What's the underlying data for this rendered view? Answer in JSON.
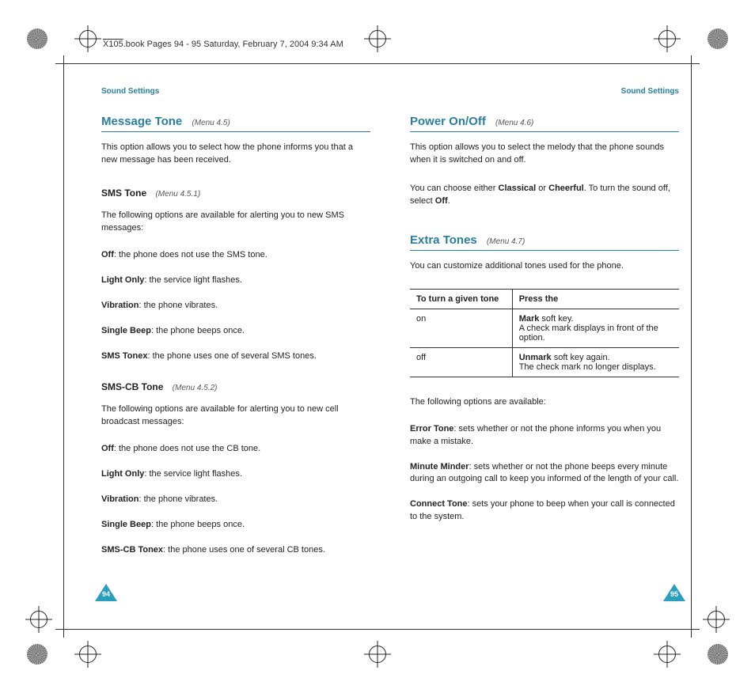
{
  "book_header": "X105.book  Pages 94 - 95  Saturday, February 7, 2004  9:34 AM",
  "runner_left": "Sound Settings",
  "runner_right": "Sound Settings",
  "left": {
    "title": "Message Tone",
    "title_ref": "(Menu 4.5)",
    "intro": "This option allows you to select how the phone informs you that a new message has been received.",
    "sub1_title": "SMS Tone",
    "sub1_ref": "(Menu 4.5.1)",
    "sub1_intro": "The following options are available for alerting you to new SMS messages:",
    "sub1_opts": [
      {
        "b": "Off",
        "t": ": the phone does not use the SMS tone."
      },
      {
        "b": "Light Only",
        "t": ": the service light flashes."
      },
      {
        "b": "Vibration",
        "t": ": the phone vibrates."
      },
      {
        "b": "Single Beep",
        "t": ": the phone beeps once."
      },
      {
        "b": "SMS Tonex",
        "t": ": the phone uses one of several SMS tones."
      }
    ],
    "sub2_title": "SMS-CB Tone",
    "sub2_ref": "(Menu 4.5.2)",
    "sub2_intro": "The following options are available for alerting you to new cell broadcast messages:",
    "sub2_opts": [
      {
        "b": "Off",
        "t": ": the phone does not use the CB tone."
      },
      {
        "b": "Light Only",
        "t": ": the service light flashes."
      },
      {
        "b": "Vibration",
        "t": ": the phone vibrates."
      },
      {
        "b": "Single Beep",
        "t": ": the phone beeps once."
      },
      {
        "b": "SMS-CB Tonex",
        "t": ": the phone uses one of several CB tones."
      }
    ],
    "page_no": "94"
  },
  "right": {
    "title1": "Power On/Off",
    "title1_ref": "(Menu 4.6)",
    "p1a": "This option allows you to select the melody that the phone sounds when it is switched on and off.",
    "p1b_pre": "You can choose either ",
    "p1b_b1": "Classical",
    "p1b_mid": " or ",
    "p1b_b2": "Cheerful",
    "p1b_post1": ". To turn the sound off, select ",
    "p1b_b3": "Off",
    "p1b_post2": ".",
    "title2": "Extra Tones",
    "title2_ref": "(Menu 4.7)",
    "p2a": "You can customize additional tones used for the phone.",
    "table": {
      "h1": "To turn a given tone",
      "h2": "Press the",
      "r1c1": "on",
      "r1c2_b": "Mark",
      "r1c2_t": " soft key.\nA check mark displays in front of the option.",
      "r2c1": "off",
      "r2c2_b": "Unmark",
      "r2c2_t": " soft key again.\nThe check mark no longer displays."
    },
    "p2b": "The following options are available:",
    "opts": [
      {
        "b": "Error Tone",
        "t": ": sets whether or not the phone informs you when you make a mistake."
      },
      {
        "b": "Minute Minder",
        "t": ": sets whether or not the phone beeps every minute during an outgoing call to keep you informed of the length of your call."
      },
      {
        "b": "Connect Tone",
        "t": ": sets your phone to beep when your call is connected to the system."
      }
    ],
    "page_no": "95"
  }
}
